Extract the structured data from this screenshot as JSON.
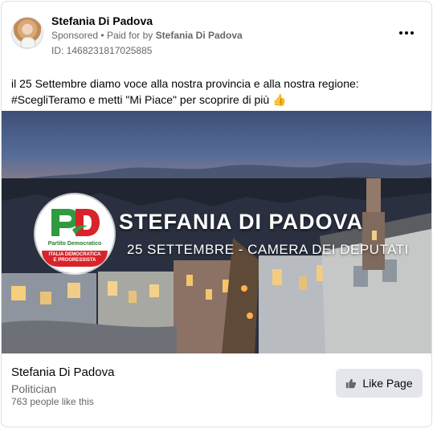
{
  "post": {
    "page_name": "Stefania Di Padova",
    "sponsored_label": "Sponsored",
    "separator": "•",
    "paid_for_text": "Paid for by",
    "paid_for_name": "Stefania Di Padova",
    "ad_id": "ID: 1468231817025885",
    "text_line_1": "il 25 Settembre diamo voce alla nostra provincia e alla nostra regione:",
    "text_line_2": "#ScegliTeramo e metti \"Mi Piace\" per scoprire di più 👍"
  },
  "image": {
    "name": "STEFANIA DI PADOVA",
    "subtitle": "25 SETTEMBRE - CAMERA DEI DEPUTATI",
    "logo_letters": "PD",
    "logo_party": "Partito Democratico",
    "logo_band_line_1": "ITALIA DEMOCRATICA",
    "logo_band_line_2": "E PROGRESSISTA"
  },
  "footer": {
    "page_name": "Stefania Di Padova",
    "category": "Politician",
    "likes": "763 people like this",
    "like_button": "Like Page"
  },
  "icons": {
    "more": "ellipsis-icon",
    "like": "thumbs-up-icon"
  },
  "colors": {
    "card_border": "#dddfe2",
    "secondary_text": "#65676b",
    "button_bg": "#e4e6eb",
    "pd_green": "#2f9a3f",
    "pd_red": "#d8232a"
  }
}
